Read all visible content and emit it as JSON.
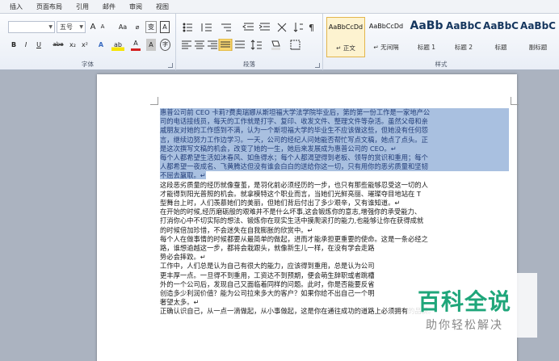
{
  "tabs": [
    "插入",
    "页面布局",
    "引用",
    "邮件",
    "审阅",
    "视图"
  ],
  "font": {
    "size_value": "五号",
    "grow_label": "A",
    "shrink_label": "A",
    "case_label": "Aa",
    "clear_label": "⌀",
    "wen_label": "变",
    "border_label": "A",
    "bold_label": "B",
    "italic_label": "I",
    "underline_label": "U",
    "strike_label": "abe",
    "sub_label": "x₂",
    "sup_label": "x²",
    "effect_label": "A",
    "highlight_label": "ab",
    "color_label": "A",
    "shade_label": "A",
    "circle_label": "字",
    "group_label": "字体"
  },
  "paragraph": {
    "group_label": "段落"
  },
  "styles": {
    "items": [
      {
        "sample": "AaBbCcDd",
        "name": "↵ 正文"
      },
      {
        "sample": "AaBbCcDd",
        "name": "↵ 无间隔"
      },
      {
        "sample": "AaBb",
        "name": "标题 1"
      },
      {
        "sample": "AaBbC",
        "name": "标题 2"
      },
      {
        "sample": "AaBbC",
        "name": "标题"
      },
      {
        "sample": "AaBbC",
        "name": "副标题"
      }
    ],
    "group_label": "样式"
  },
  "document": {
    "selected_lines": [
      "惠普公司前 CEO 卡莉?费奥瑞娜从斯坦福大学法学院毕业后，第的第一份工作是一家地产公",
      "司的电话接线员，每天的工作就是打字、复印、收发文件、整理文件等杂活。虽然父母和亲",
      "戚朋友对她的工作感到不满，认为一个斯坦福大学的毕业生不应该做这些，但她没有任何怨",
      "言，继续边努力工作边学习。一天，公司的经纪人问她能否帮忙写点文稿，她点了点头。正",
      "是这次撰写文稿的机会，改变了她的一生，她后来发展成为惠普公司的 CEO。↵",
      "每个人都希望生活如沐春风、如鱼得水；每个人都渴望得到老板、领导的赏识和重用；每个",
      "人都希望一夜成名、飞黄腾达但没有谁会白白的送给你这一切，只有用你的恶劣质量和坚韧",
      "不屈去赢取。↵"
    ],
    "lines": [
      "这段恶劣质量的经历就像蚕茧，是羽化前必须经历的一步，也只有那些能够忍受这一切的人",
      "才能得到阳光普照的机会。就拿模特这个职业而言，当她们光鲜亮丽、璀璨夺目地站在 T",
      "型舞台上时，人们羡慕她们的美丽，但她们背后付出了多少艰辛，又有谁知道。↵",
      "在开始的时候,经历磨砺般的艰难并不是什么坏事,这会锻炼你的意志,增强你的承受能力、",
      "打消你心中不切实际的想法、锻炼你在现实生活中摸爬滚打的能力,也能够让你在获得成就",
      "的时候倍加珍惜，不会迷失在自我膨胀的欣赏中。↵",
      "每个人在做事情的时候都要从最简单的做起，进而才能承担更重要的使命。这是一条必经之",
      "路，谁想逾越这一步，都将会栽跟头，就像新生儿一样，在没有学会走路",
      "势必会摔跤。↵",
      "工作中，人们总是认为自己有很大的能力，应该得到重用，总是认为公司",
      "更丰厚一点。一旦得不到重用，工资达不到预期，便会萌生辞职或者跳槽",
      "外的一个公司后，发现自己又面临着同样的问题。此时，你是否能要反省",
      "创造多少利润价值？能为公司拉来多大的客户？如果你给不出自己一个明",
      "奢望太多。↵",
      "正确认识自己，从一点一滴做起，从小事做起，这是你在通往成功的道路上必须拥有的品质。"
    ]
  },
  "watermark": {
    "title": "百科全说",
    "subtitle": "助你轻松解决"
  }
}
